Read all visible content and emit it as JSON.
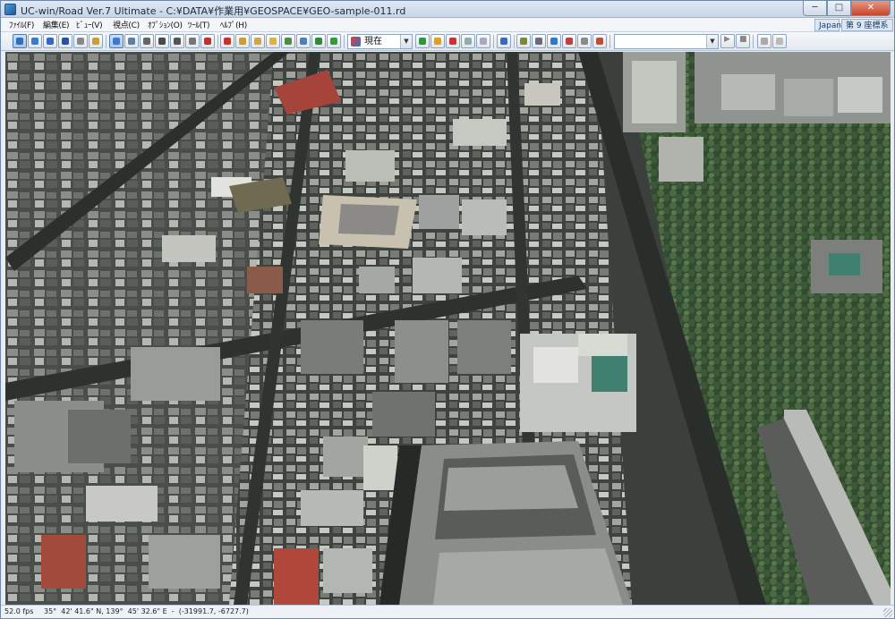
{
  "window": {
    "title": "UC-win/Road Ver.7 Ultimate - C:¥DATA¥作業用¥GEOSPACE¥GEO-sample-011.rd",
    "min_glyph": "─",
    "max_glyph": "□",
    "close_glyph": "✕"
  },
  "menu": {
    "items": [
      "ﾌｧｲﾙ(F)",
      "編集(E)",
      "ﾋﾞｭｰ(V)",
      "視点(C)",
      "ｵﾌﾟｼｮﾝ(O)",
      "ﾂｰﾙ(T)",
      "ﾍﾙﾌﾟ(H)"
    ],
    "language": "Japan",
    "coordinate_system": "第 9 座標系"
  },
  "toolbar": {
    "time_combo": "現在",
    "combo_arrow": "▼",
    "play_glyph": "▶",
    "stop_glyph": "■",
    "icons": [
      "move-mode-icon",
      "rotate-down-icon",
      "pan-icon",
      "fly-icon",
      "walk-icon",
      "zoom-icon",
      "select-icon",
      "camera-icon",
      "play-script-icon",
      "record-icon",
      "car-icon",
      "drive-icon",
      "compass-icon",
      "stop-icon",
      "terrain-icon",
      "model-icon",
      "texture-icon",
      "light-icon",
      "road-icon",
      "tree-icon",
      "tree-alt-icon",
      "map-icon",
      "time-icon",
      "signal-green-icon",
      "signal-yellow-icon",
      "signal-red-icon",
      "cross-section-icon",
      "lock-icon",
      "pen-icon",
      "layer-icon",
      "weather-icon",
      "network-icon",
      "report-icon",
      "export-icon",
      "cut-icon",
      "tools-icon"
    ],
    "accent": "#4f79a8"
  },
  "status": {
    "fps": "52.0 fps",
    "position": "35°  42' 41.6\" N, 139°  45' 32.6\" E  -  (-31991.7, -6727.7)"
  },
  "view": {
    "description_colors": {
      "asphalt": "#3b403d",
      "roof_gray": "#9a9d9c",
      "roof_white": "#d9dbd6",
      "trees": "#3e5a3a",
      "roof_red": "#a5443a"
    }
  }
}
